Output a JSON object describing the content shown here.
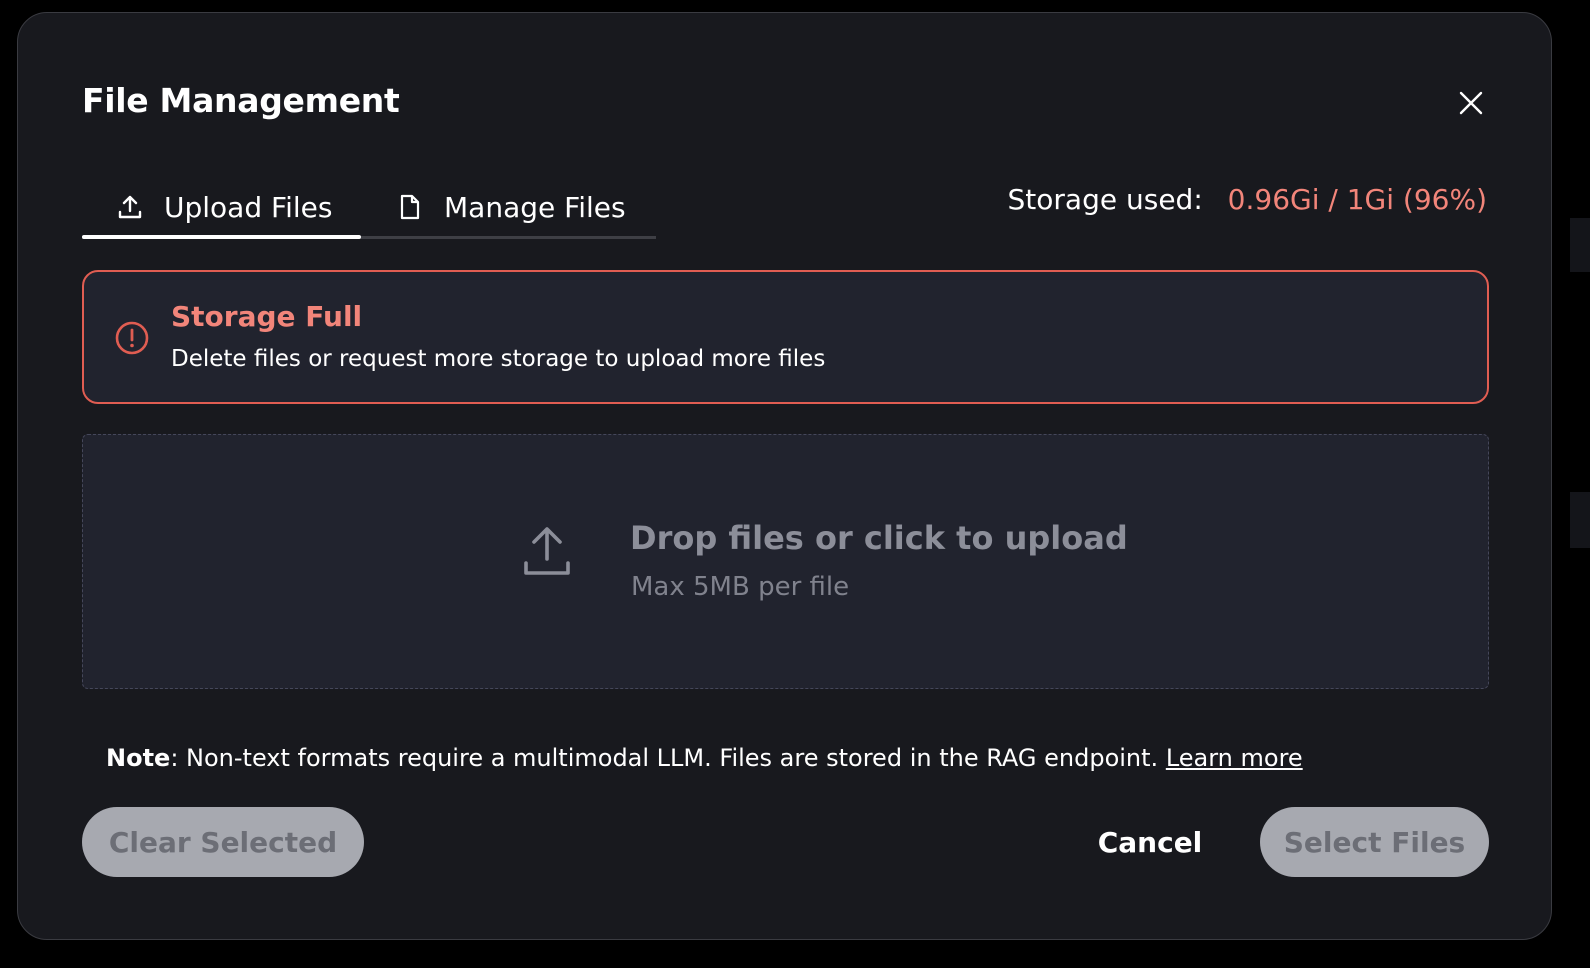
{
  "dialog": {
    "title": "File Management",
    "close_icon": "close-icon"
  },
  "tabs": [
    {
      "label": "Upload Files",
      "icon": "upload-icon",
      "active": true
    },
    {
      "label": "Manage Files",
      "icon": "file-icon",
      "active": false
    }
  ],
  "storage": {
    "label": "Storage used:",
    "value": "0.96Gi / 1Gi (96%)",
    "used_fraction": 0.96,
    "value_color": "#f2857a"
  },
  "alert": {
    "icon": "alert-circle-icon",
    "title": "Storage Full",
    "message": "Delete files or request more storage to upload more files",
    "border_color": "#e05d52",
    "title_color": "#f2857a"
  },
  "dropzone": {
    "icon": "upload-icon",
    "title": "Drop files or click to upload",
    "subtitle": "Max 5MB per file"
  },
  "note": {
    "label": "Note",
    "text": ": Non-text formats require a multimodal LLM. Files are stored in the RAG endpoint. ",
    "link": "Learn more"
  },
  "footer": {
    "clear_label": "Clear Selected",
    "cancel_label": "Cancel",
    "select_label": "Select Files"
  },
  "colors": {
    "dialog_bg": "#18191e",
    "panel_bg": "#21232e",
    "disabled_button_bg": "#a7a9b0"
  }
}
